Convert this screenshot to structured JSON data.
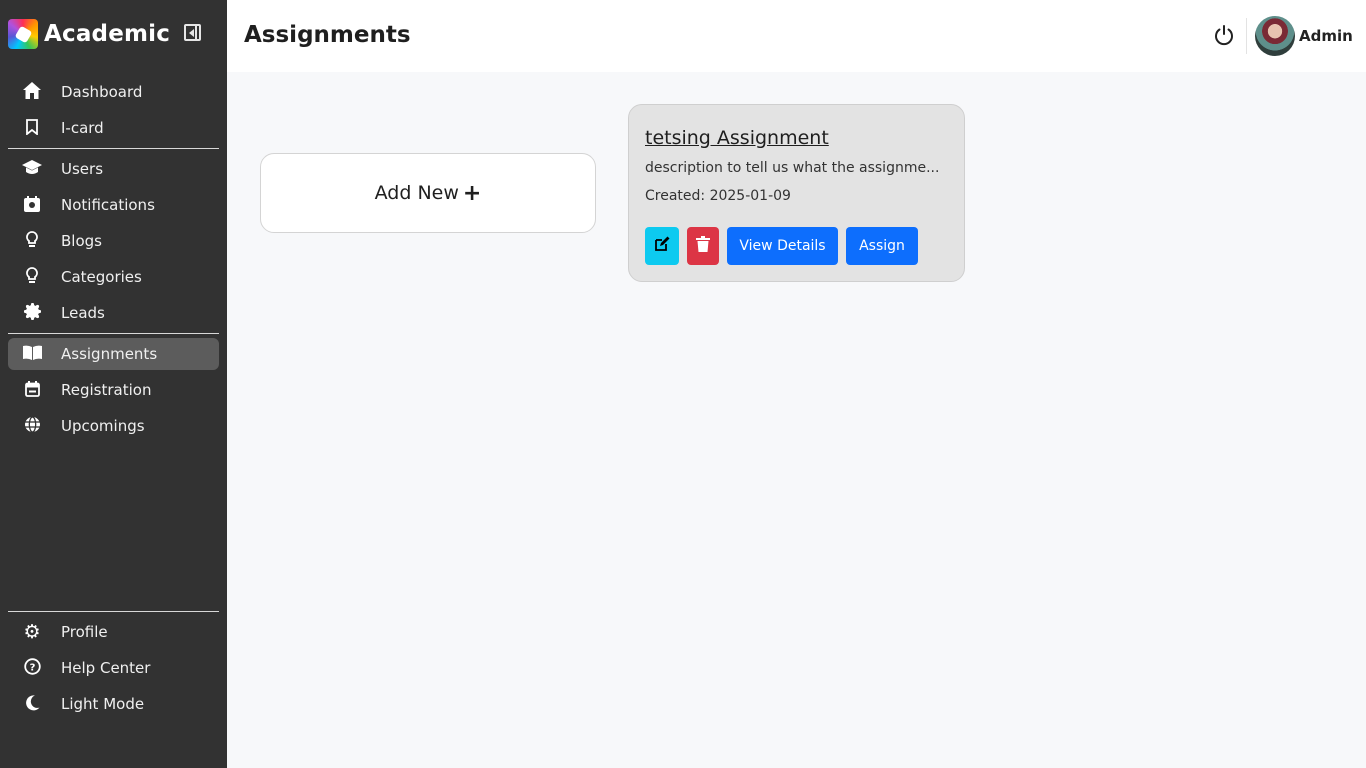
{
  "app": {
    "name": "Academic"
  },
  "sidebar": {
    "primary": [
      {
        "label": "Dashboard",
        "icon": "home-icon",
        "glyph": "⌂"
      },
      {
        "label": "I-card",
        "icon": "bookmark-icon",
        "glyph": "🔖"
      }
    ],
    "management": [
      {
        "label": "Users",
        "icon": "graduation-cap-icon",
        "glyph": "🎓"
      },
      {
        "label": "Notifications",
        "icon": "calendar-box-icon",
        "glyph": "▣"
      },
      {
        "label": "Blogs",
        "icon": "lightbulb-icon",
        "glyph": "💡"
      },
      {
        "label": "Categories",
        "icon": "lightbulb-icon",
        "glyph": "💡"
      },
      {
        "label": "Leads",
        "icon": "badge-icon",
        "glyph": "✹"
      }
    ],
    "academic": [
      {
        "label": "Assignments",
        "icon": "book-open-icon",
        "glyph": "📖",
        "active": true
      },
      {
        "label": "Registration",
        "icon": "calendar-icon",
        "glyph": "📅"
      },
      {
        "label": "Upcomings",
        "icon": "globe-icon",
        "glyph": "🌐"
      }
    ],
    "bottom": [
      {
        "label": "Profile",
        "icon": "gear-icon",
        "glyph": "⚙"
      },
      {
        "label": "Help Center",
        "icon": "question-circle-icon",
        "glyph": "?"
      },
      {
        "label": "Light Mode",
        "icon": "moon-icon",
        "glyph": "☾"
      }
    ]
  },
  "header": {
    "title": "Assignments",
    "user_name": "Admin"
  },
  "main": {
    "add_new_label": "Add New",
    "add_new_glyph": "+",
    "assignments": [
      {
        "title": "tetsing Assignment",
        "description": "description to tell us what the assignme...",
        "created": "Created: 2025-01-09",
        "view_label": "View Details",
        "assign_label": "Assign"
      }
    ]
  },
  "colors": {
    "sidebar_bg": "#323232",
    "active_bg": "#5c5c5c",
    "edit_btn": "#0dcaf0",
    "delete_btn": "#dc3545",
    "primary_btn": "#0d6efd"
  }
}
